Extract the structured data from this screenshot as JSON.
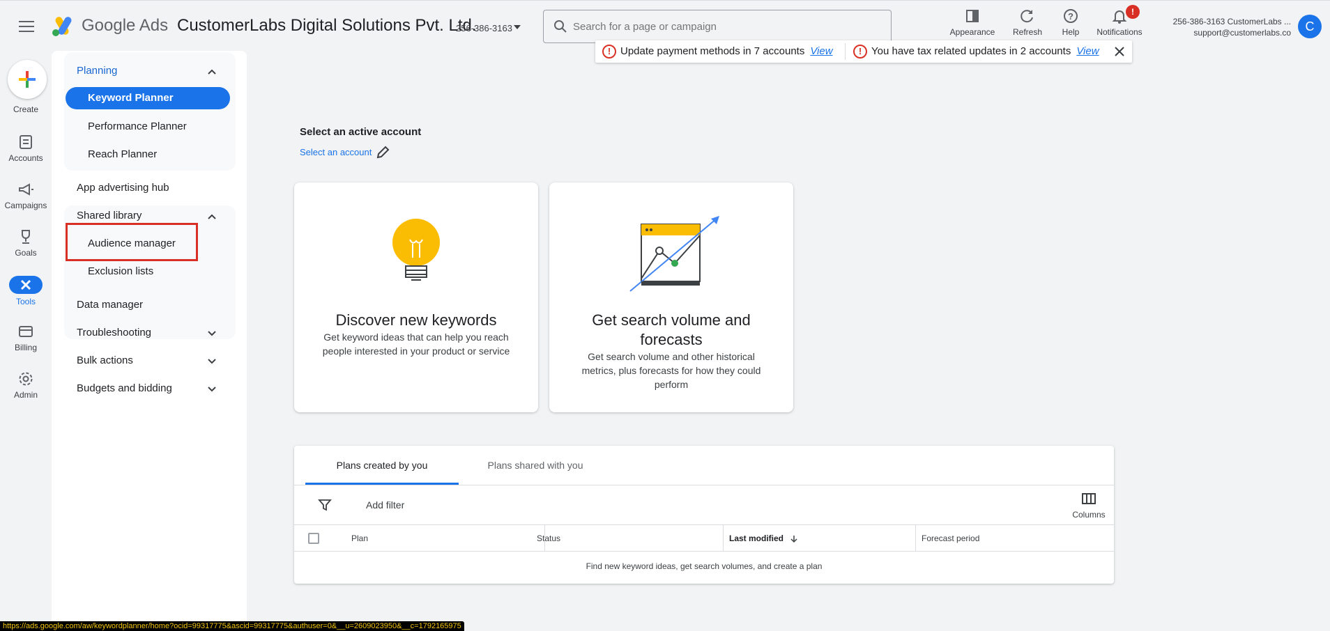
{
  "header": {
    "brand": "Google Ads",
    "account_name": "CustomerLabs Digital Solutions Pvt. Ltd.",
    "account_id": "256-386-3163",
    "search_placeholder": "Search for a page or campaign",
    "appearance_label": "Appearance",
    "refresh_label": "Refresh",
    "help_label": "Help",
    "notifications_label": "Notifications",
    "notifications_badge": "!",
    "user_line1": "256-386-3163 CustomerLabs ...",
    "user_line2": "support@customerlabs.co",
    "avatar_letter": "C"
  },
  "alerts": {
    "payment_text": "Update payment methods in 7 accounts",
    "payment_link": "View",
    "tax_text": "You have tax related updates in 2 accounts",
    "tax_link": "View",
    "icon_glyph": "!"
  },
  "rail": {
    "create": "Create",
    "accounts": "Accounts",
    "campaigns": "Campaigns",
    "goals": "Goals",
    "tools": "Tools",
    "billing": "Billing",
    "admin": "Admin"
  },
  "nav": {
    "planning": "Planning",
    "keyword_planner": "Keyword Planner",
    "performance_planner": "Performance Planner",
    "reach_planner": "Reach Planner",
    "app_hub": "App advertising hub",
    "shared_library": "Shared library",
    "audience_manager": "Audience manager",
    "exclusion_lists": "Exclusion lists",
    "data_manager": "Data manager",
    "troubleshooting": "Troubleshooting",
    "bulk_actions": "Bulk actions",
    "budgets_bidding": "Budgets and bidding"
  },
  "main": {
    "select_title": "Select an active account",
    "select_link": "Select an account",
    "card1_title": "Discover new keywords",
    "card1_desc": "Get keyword ideas that can help you reach people interested in your product or service",
    "card2_title": "Get search volume and forecasts",
    "card2_desc": "Get search volume and other historical metrics, plus forecasts for how they could perform"
  },
  "plans": {
    "tab_created": "Plans created by you",
    "tab_shared": "Plans shared with you",
    "add_filter": "Add filter",
    "columns": "Columns",
    "col_plan": "Plan",
    "col_status": "Status",
    "col_last_modified": "Last modified",
    "col_forecast": "Forecast period",
    "empty": "Find new keyword ideas, get search volumes, and create a plan"
  },
  "statusbar": {
    "url": "https://ads.google.com/aw/keywordplanner/home?ocid=99317775&ascid=99317775&authuser=0&__u=2609023950&__c=1792165975"
  },
  "colors": {
    "accent": "#1a73e8",
    "alert_red": "#d93025",
    "bulb": "#fbbc04"
  }
}
